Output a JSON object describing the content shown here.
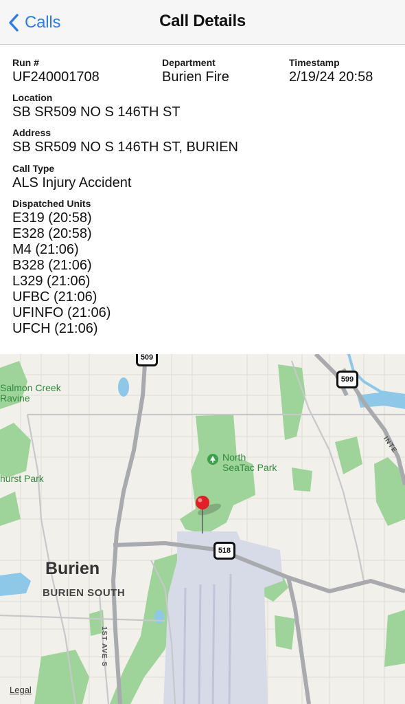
{
  "nav": {
    "back_label": "Calls",
    "title": "Call Details"
  },
  "call": {
    "run": {
      "label": "Run #",
      "value": "UF240001708"
    },
    "department": {
      "label": "Department",
      "value": "Burien Fire"
    },
    "timestamp": {
      "label": "Timestamp",
      "value": "2/19/24 20:58"
    },
    "location": {
      "label": "Location",
      "value": "SB SR509 NO S 146TH ST"
    },
    "address": {
      "label": "Address",
      "value": "SB SR509 NO S 146TH ST, BURIEN"
    },
    "call_type": {
      "label": "Call Type",
      "value": "ALS Injury Accident"
    },
    "dispatched": {
      "label": "Dispatched Units",
      "units": [
        "E319 (20:58)",
        "E328 (20:58)",
        "M4 (21:06)",
        "B328 (21:06)",
        "L329 (21:06)",
        "UFBC (21:06)",
        "UFINFO (21:06)",
        "UFCH (21:06)"
      ]
    }
  },
  "map": {
    "labels": {
      "salmon_creek": "Salmon Creek\nRavine",
      "hurst_park": "hurst Park",
      "north_seatac_park": "North\nSeaTac Park",
      "burien": "Burien",
      "burien_south": "BURIEN SOUTH",
      "first_ave": "1ST AVE S",
      "interstate": "INTE"
    },
    "shields": {
      "sr509": "509",
      "sr599": "599",
      "sr518": "518"
    },
    "legal": "Legal",
    "colors": {
      "land": "#f2f0ea",
      "park": "#9ed39a",
      "road": "#a9aaad",
      "water": "#8dc8e8",
      "airport": "#d7dbe8",
      "pin": "#e41e26"
    }
  },
  "theme": {
    "accent": "#2b7bf6"
  }
}
